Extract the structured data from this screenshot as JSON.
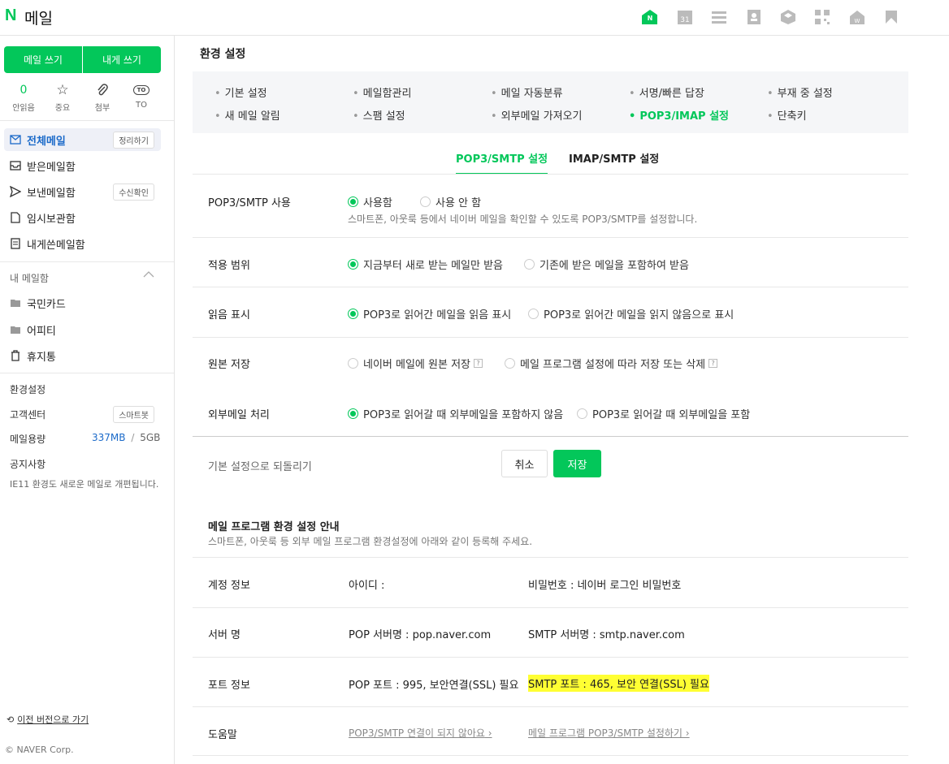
{
  "header": {
    "logo": "N",
    "title": "메일",
    "icons": [
      "mail-open-icon",
      "calendar-icon",
      "list-icon",
      "contact-icon",
      "cube-icon",
      "qr-icon",
      "home-icon",
      "bookmark-icon"
    ],
    "calendar_day": "31"
  },
  "sidebar": {
    "write_label": "메일 쓰기",
    "self_label": "내게 쓰기",
    "quick": [
      {
        "value": "0",
        "label": "안읽음"
      },
      {
        "value": "☆",
        "label": "중요"
      },
      {
        "value": "📎",
        "label": "첨부"
      },
      {
        "value": "TO",
        "label": "TO"
      }
    ],
    "nav": [
      {
        "label": "전체메일",
        "pill": "정리하기"
      },
      {
        "label": "받은메일함"
      },
      {
        "label": "보낸메일함",
        "pill": "수신확인"
      },
      {
        "label": "임시보관함"
      },
      {
        "label": "내게쓴메일함"
      }
    ],
    "my_mailbox_title": "내 메일함",
    "folders": [
      "국민카드",
      "어피티",
      "휴지통"
    ],
    "settings": "환경설정",
    "support": "고객센터",
    "support_pill": "스마트봇",
    "storage_label": "메일용량",
    "storage_used": "337MB",
    "storage_sep": "/",
    "storage_total": "5GB",
    "notice_title": "공지사항",
    "notice_text": "IE11 환경도 새로운 메일로 개편됩니다.",
    "prev_version": "이전 버전으로 가기",
    "copyright": "© NAVER Corp."
  },
  "main": {
    "title": "환경 설정",
    "menu": [
      "기본 설정",
      "메일함관리",
      "메일 자동분류",
      "서명/빠른 답장",
      "부재 중 설정",
      "새 메일 알림",
      "스팸 설정",
      "외부메일 가져오기",
      "POP3/IMAP 설정",
      "단축키"
    ],
    "tabs": [
      "POP3/SMTP 설정",
      "IMAP/SMTP 설정"
    ],
    "rows": [
      {
        "label": "POP3/SMTP 사용",
        "opt1": "사용함",
        "opt2": "사용 안 함",
        "desc": "스마트폰, 아웃룩 등에서 네이버 메일을 확인할 수 있도록 POP3/SMTP를 설정합니다."
      },
      {
        "label": "적용 범위",
        "opt1": "지금부터 새로 받는 메일만 받음",
        "opt2": "기존에 받은 메일을 포함하여 받음"
      },
      {
        "label": "읽음 표시",
        "opt1": "POP3로 읽어간 메일을 읽음 표시",
        "opt2": "POP3로 읽어간 메일을 읽지 않음으로 표시"
      },
      {
        "label": "원본 저장",
        "opt1": "네이버 메일에 원본 저장",
        "opt2": "메일 프로그램 설정에 따라 저장 또는 삭제"
      },
      {
        "label": "외부메일 처리",
        "opt1": "POP3로 읽어갈 때 외부메일을 포함하지 않음",
        "opt2": "POP3로 읽어갈 때 외부메일을 포함"
      }
    ],
    "reset_label": "기본 설정으로 되돌리기",
    "cancel_label": "취소",
    "save_label": "저장",
    "guide_title": "메일 프로그램 환경 설정 안내",
    "guide_desc": "스마트폰, 아웃룩 등 외부 메일 프로그램 환경설정에 아래와 같이 등록해 주세요.",
    "guide": [
      {
        "label": "계정 정보",
        "c1": "아이디 :",
        "c2": "비밀번호 : 네이버 로그인 비밀번호"
      },
      {
        "label": "서버 명",
        "c1": "POP 서버명 : pop.naver.com",
        "c2": "SMTP 서버명 : smtp.naver.com"
      },
      {
        "label": "포트 정보",
        "c1": "POP 포트 : 995, 보안연결(SSL) 필요",
        "c2": "SMTP 포트 : 465, 보안 연결(SSL) 필요"
      },
      {
        "label": "도움말",
        "c1": "POP3/SMTP 연결이 되지 않아요",
        "c2": "메일 프로그램 POP3/SMTP 설정하기"
      }
    ],
    "highlight_color": "#ffff33",
    "accent_color": "#03c75a"
  }
}
